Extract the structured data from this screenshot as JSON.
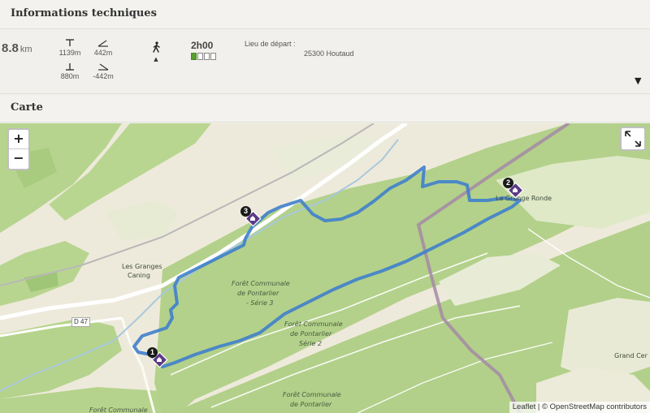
{
  "info": {
    "title": "Informations techniques",
    "distance_value": "8.8",
    "distance_unit": "km",
    "max_altitude": "1139m",
    "min_altitude": "880m",
    "positive_elevation": "442m",
    "negative_elevation": "-442m",
    "activity_icon": "hiker-icon",
    "duration": "2h00",
    "difficulty": {
      "level": 1,
      "max": 4,
      "active_color": "#5a9e2e"
    },
    "start_label": "Lieu de départ :",
    "start_value": "25300 Houtaud"
  },
  "map": {
    "title": "Carte",
    "zoom_in": "+",
    "zoom_out": "−",
    "labels": {
      "les_granges_1": "Les Granges",
      "les_granges_2": "Caning",
      "grange_ronde": "La Grange Ronde",
      "grand_cer": "Grand Cer",
      "road": "D 47",
      "foret1_a": "Forêt Communale",
      "foret1_b": "de Pontarlier",
      "foret1_c": "- Série 3",
      "foret2_a": "Forêt Communale",
      "foret2_b": "de Pontarlier",
      "foret2_c": "Série 2",
      "foret3_a": "Forêt Communale",
      "foret3_b": "de Pontarlier",
      "foret4": "Forêt Communale"
    },
    "markers": [
      "1",
      "2",
      "3"
    ],
    "route_color": "#3f7fcc",
    "attribution_leaflet": "Leaflet",
    "attribution_sep": " | © ",
    "attribution_osm": "OpenStreetMap contributors"
  }
}
